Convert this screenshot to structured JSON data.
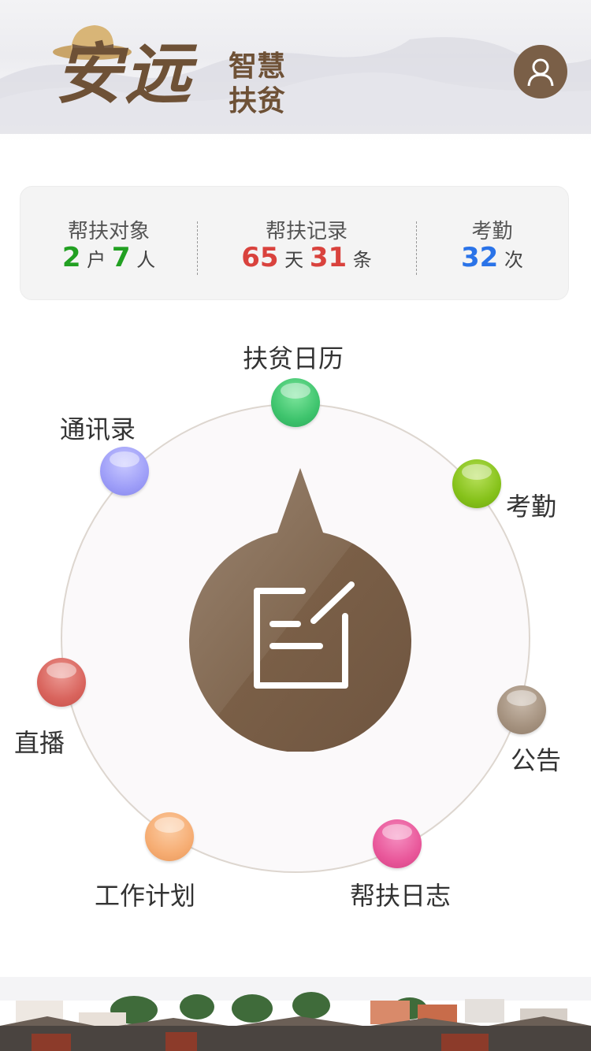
{
  "header": {
    "logo_main": "安远",
    "logo_sub_line1": "智慧",
    "logo_sub_line2": "扶贫",
    "avatar_icon": "user-icon"
  },
  "stats": {
    "targets": {
      "label": "帮扶对象",
      "households": "2",
      "households_unit": "户",
      "people": "7",
      "people_unit": "人"
    },
    "records": {
      "label": "帮扶记录",
      "days": "65",
      "days_unit": "天",
      "count": "31",
      "count_unit": "条"
    },
    "attendance": {
      "label": "考勤",
      "times": "32",
      "times_unit": "次"
    }
  },
  "menu": {
    "center_icon": "edit-note-icon",
    "items": [
      {
        "label": "扶贫日历",
        "color": "#3ec46d"
      },
      {
        "label": "考勤",
        "color": "#86c21a"
      },
      {
        "label": "公告",
        "color": "#a5927f"
      },
      {
        "label": "帮扶日志",
        "color": "#e9579a"
      },
      {
        "label": "工作计划",
        "color": "#f6ad73"
      },
      {
        "label": "直播",
        "color": "#d9645d"
      },
      {
        "label": "通讯录",
        "color": "#9e9ef8"
      }
    ]
  },
  "colors": {
    "brand_brown": "#7a5f47",
    "green": "#22a022",
    "red": "#d9423d",
    "blue": "#2a73e8"
  }
}
